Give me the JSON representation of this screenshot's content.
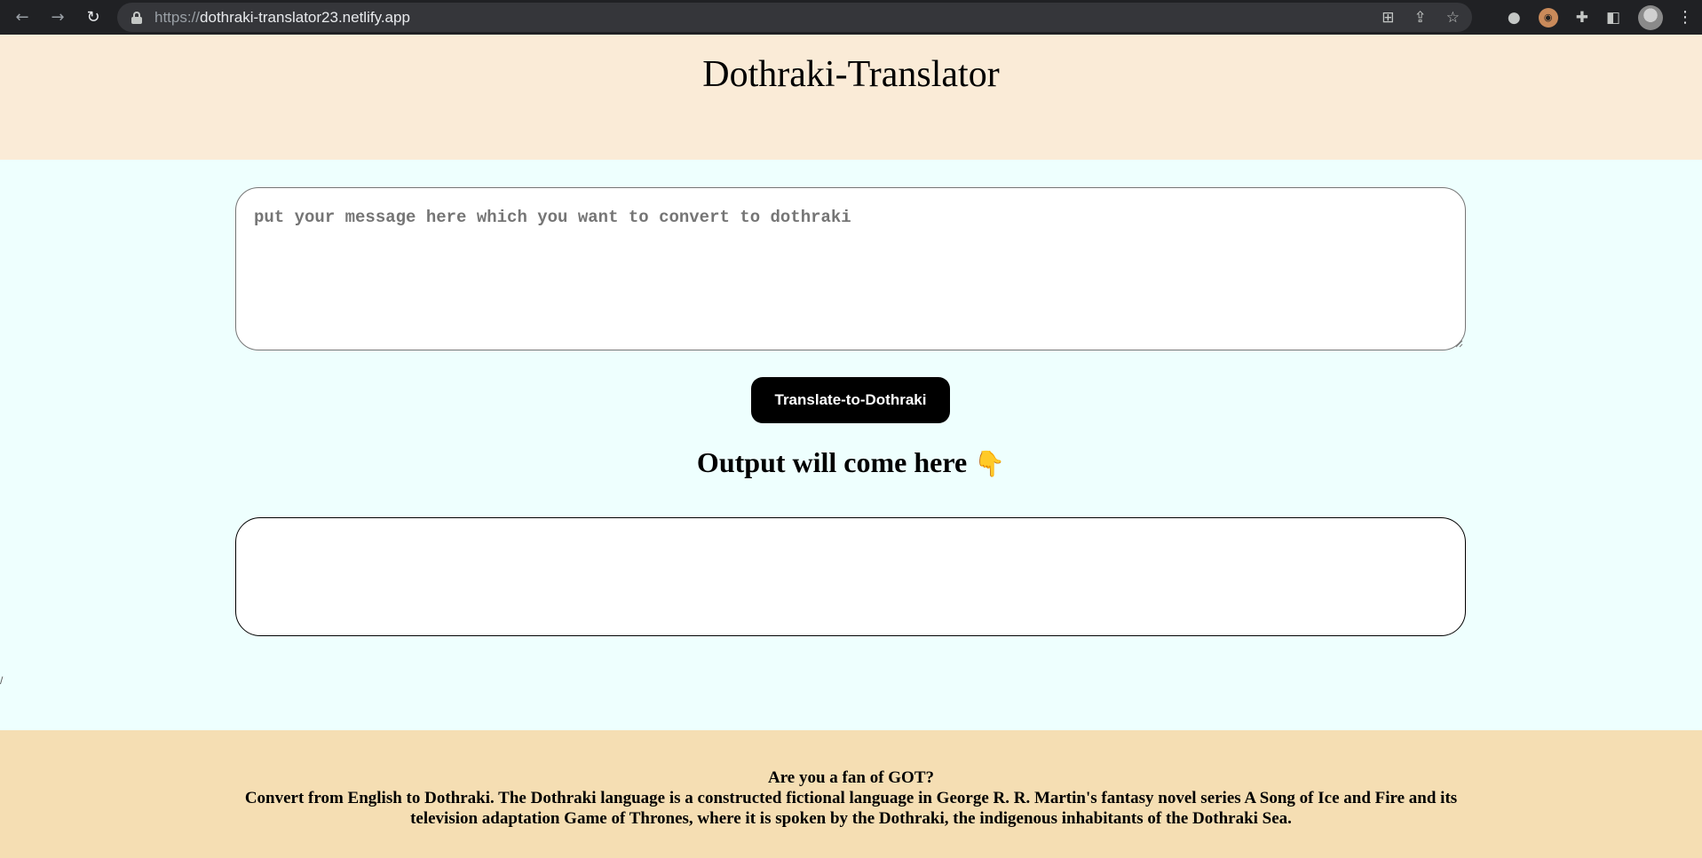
{
  "browser": {
    "url_scheme": "https://",
    "url_host": "dothraki-translator23.netlify.app"
  },
  "header": {
    "title": "Dothraki-Translator"
  },
  "main": {
    "input_placeholder": "put your message here which you want to convert to dothraki",
    "input_value": "",
    "translate_button_label": "Translate-to-Dothraki",
    "output_heading": "Output will come here",
    "output_icon": "👇",
    "output_text": "",
    "edge_mark": "/"
  },
  "footer": {
    "question": "Are you a fan of GOT?",
    "description": "Convert from English to Dothraki. The Dothraki language is a constructed fictional language in George R. R. Martin's fantasy novel series A Song of Ice and Fire and its television adaptation Game of Thrones, where it is spoken by the Dothraki, the indigenous inhabitants of the Dothraki Sea."
  },
  "colors": {
    "header_bg": "#faebd7",
    "main_bg": "#eefffe",
    "footer_bg": "#f5deb3",
    "button_bg": "#000000"
  }
}
